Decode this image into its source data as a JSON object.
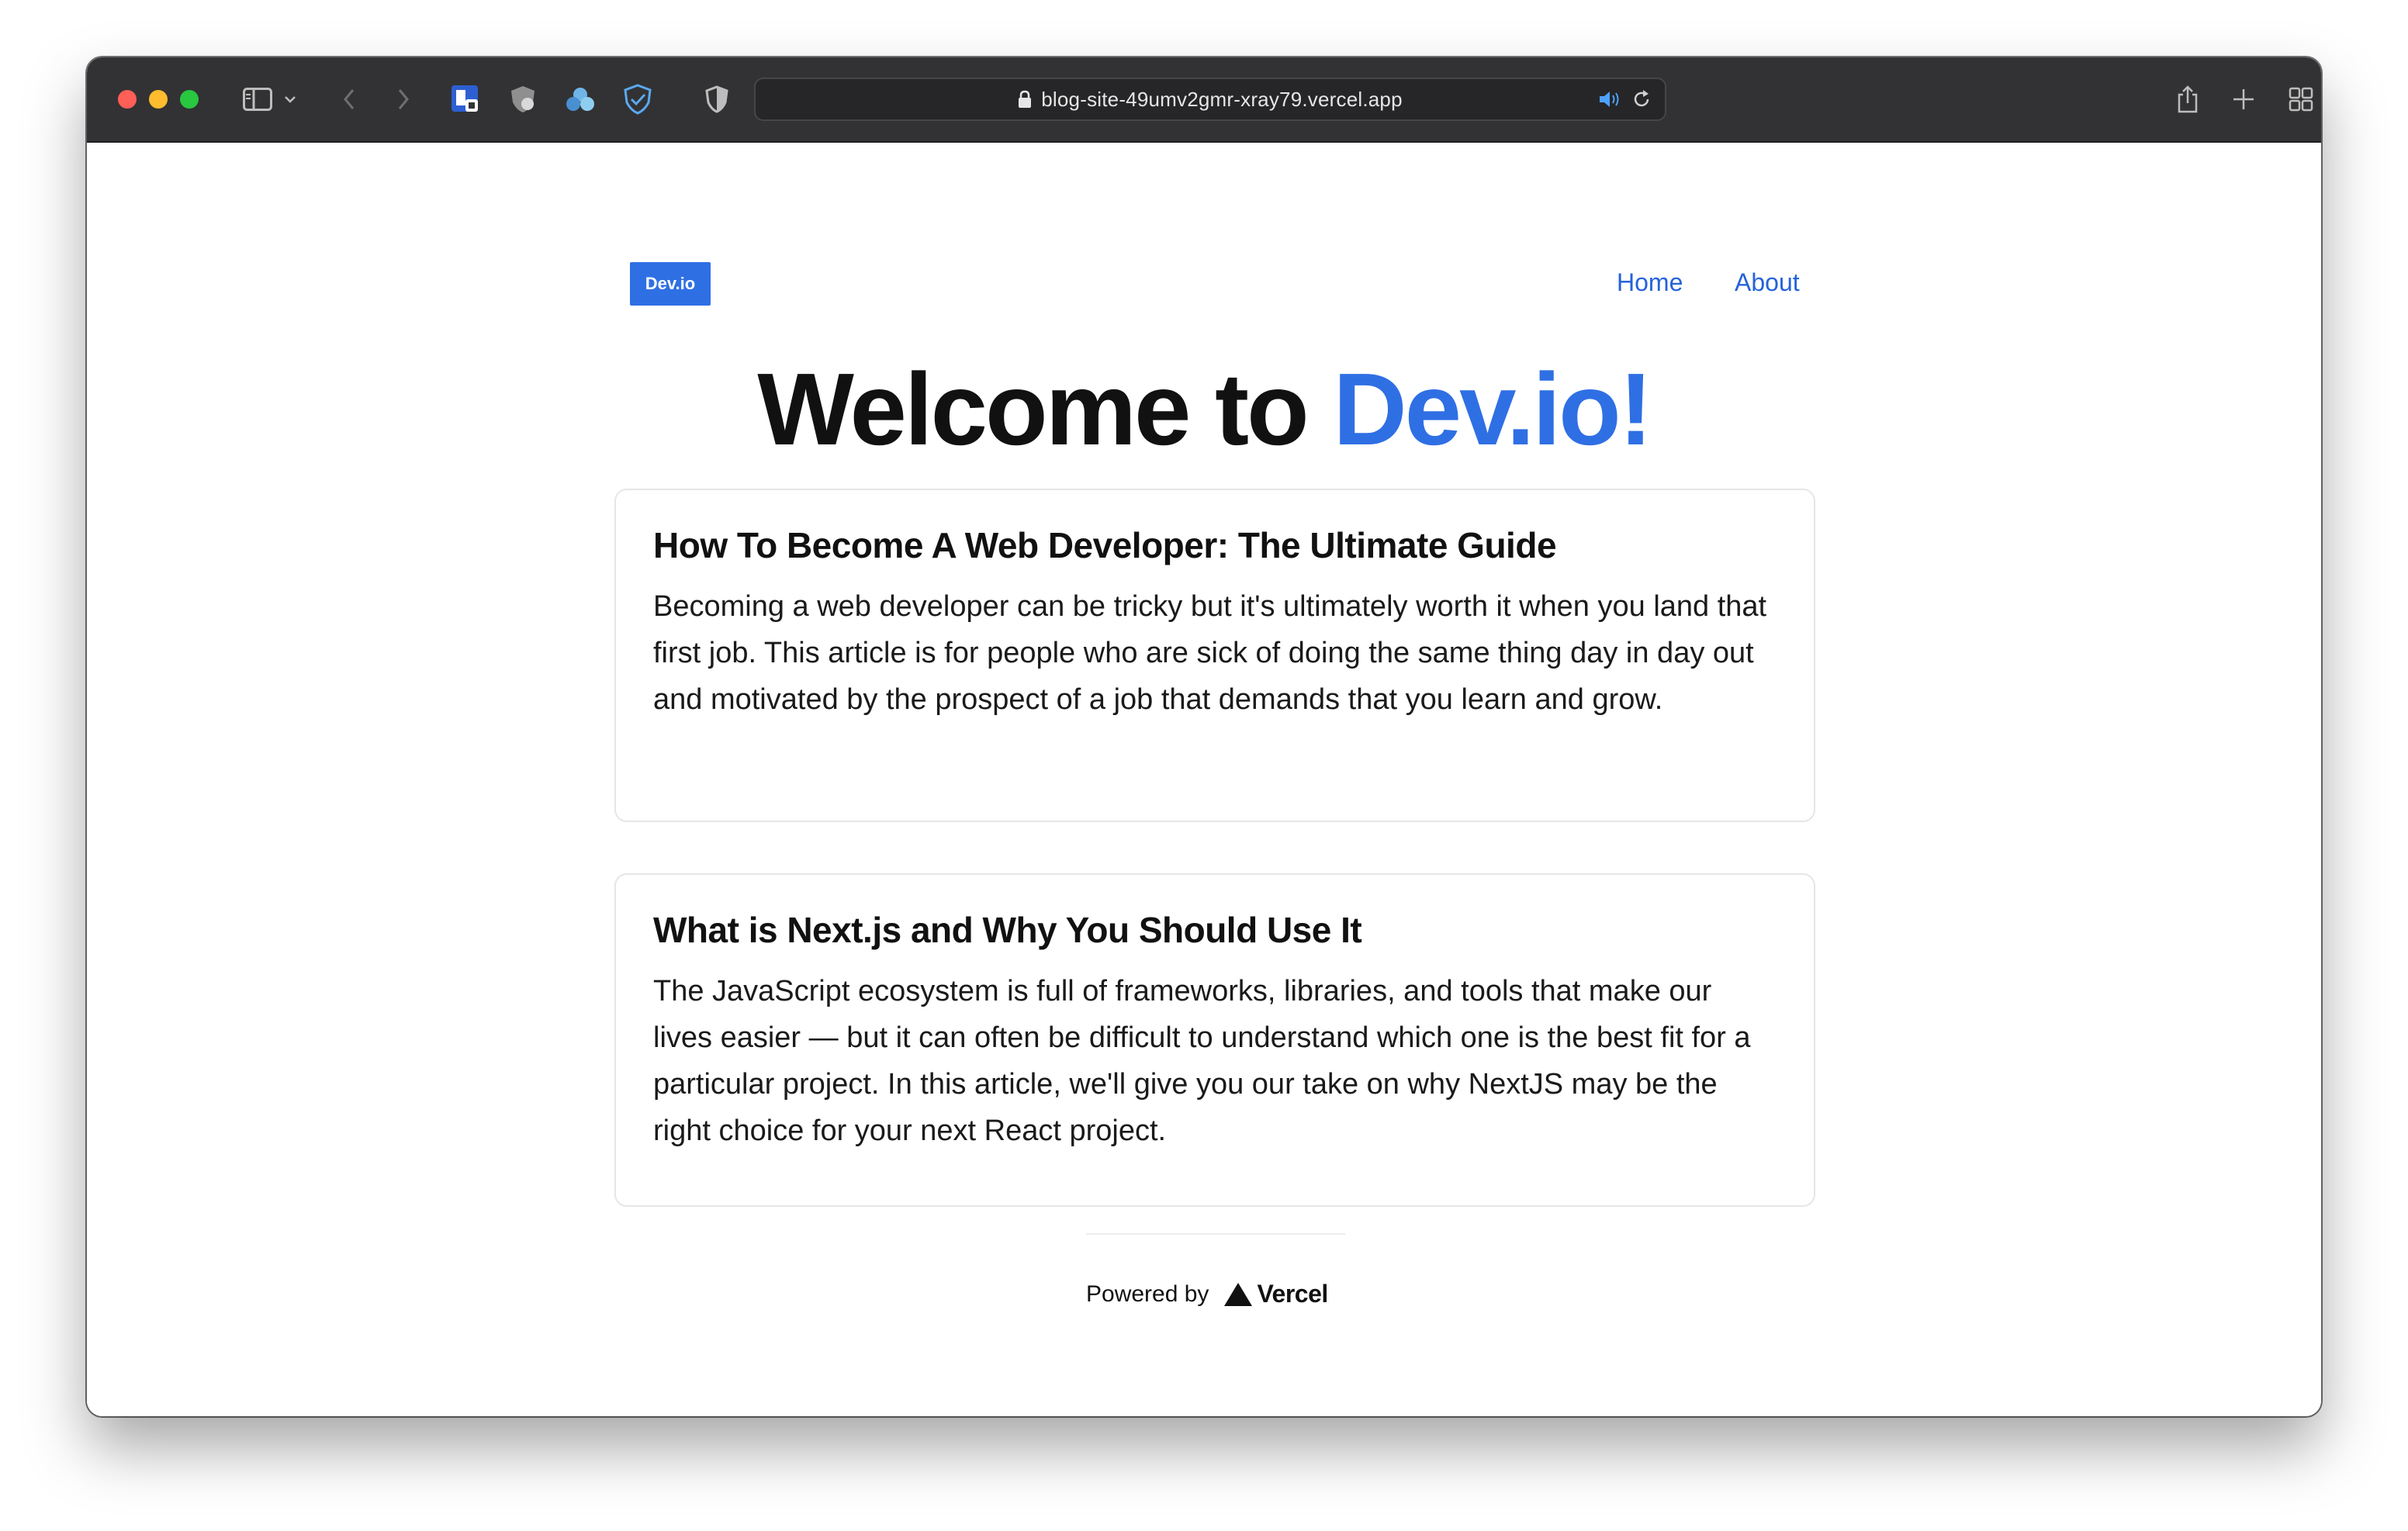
{
  "browser": {
    "url": "blog-site-49umv2gmr-xray79.vercel.app",
    "icons": [
      "sidebar-icon",
      "chevron-down-icon",
      "back-icon",
      "forward-icon",
      "extension-icon",
      "extension-icon",
      "extension-icon",
      "extension-icon",
      "privacy-shield-icon",
      "lock-icon",
      "speaker-icon",
      "reload-icon",
      "share-icon",
      "new-tab-icon",
      "tab-overview-icon"
    ]
  },
  "header": {
    "logo": "Dev.io",
    "nav": [
      {
        "label": "Home"
      },
      {
        "label": "About"
      }
    ]
  },
  "hero": {
    "prefix": "Welcome to",
    "accent": "Dev.io!"
  },
  "posts": [
    {
      "title": "How To Become A Web Developer: The Ultimate Guide",
      "excerpt": "Becoming a web developer can be tricky but it's ultimately worth it when you land that first job. This article is for people who are sick of doing the same thing day in day out and motivated by the prospect of a job that demands that you learn and grow."
    },
    {
      "title": "What is Next.js and Why You Should Use It",
      "excerpt": "The JavaScript ecosystem is full of frameworks, libraries, and tools that make our lives easier — but it can often be difficult to understand which one is the best fit for a particular project. In this article, we'll give you our take on why NextJS may be the right choice for your next React project."
    }
  ],
  "footer": {
    "powered_by": "Powered by",
    "brand": "Vercel"
  },
  "colors": {
    "accent": "#2f6fe4",
    "link": "#2563d9",
    "toolbar": "#323234"
  }
}
